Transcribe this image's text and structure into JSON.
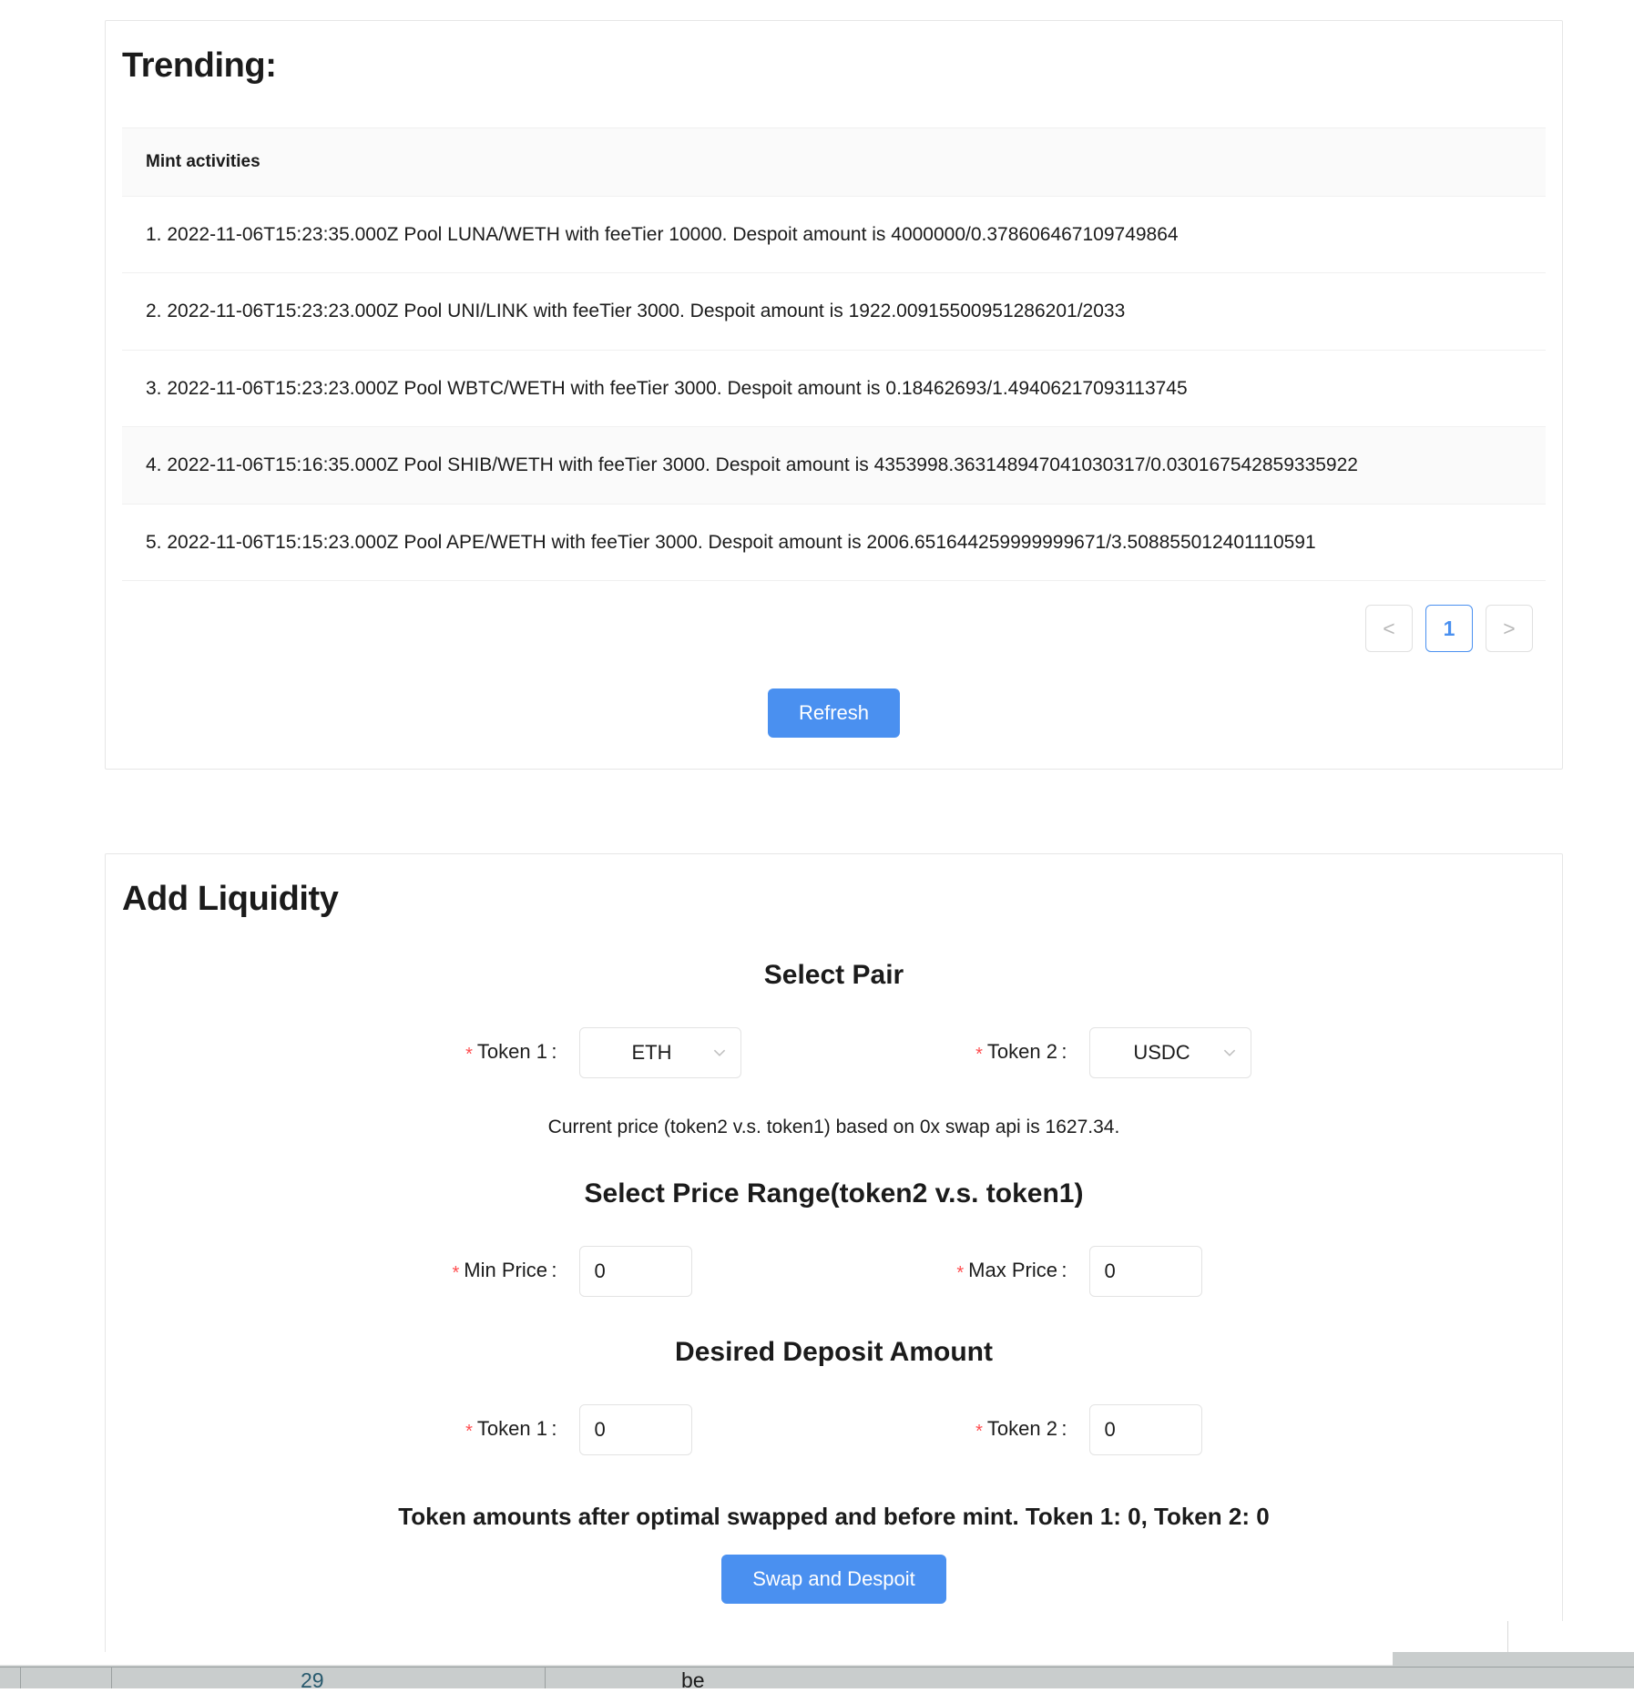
{
  "trending": {
    "title": "Trending:",
    "list_header": "Mint activities",
    "items": [
      "1. 2022-11-06T15:23:35.000Z Pool LUNA/WETH with feeTier 10000. Despoit amount is 4000000/0.378606467109749864",
      "2. 2022-11-06T15:23:23.000Z Pool UNI/LINK with feeTier 3000. Despoit amount is 1922.00915500951286201/2033",
      "3. 2022-11-06T15:23:23.000Z Pool WBTC/WETH with feeTier 3000. Despoit amount is 0.18462693/1.49406217093113745",
      "4. 2022-11-06T15:16:35.000Z Pool SHIB/WETH with feeTier 3000. Despoit amount is 4353998.363148947041030317/0.030167542859335922",
      "5. 2022-11-06T15:15:23.000Z Pool APE/WETH with feeTier 3000. Despoit amount is 2006.651644259999999671/3.508855012401110591"
    ],
    "pagination": {
      "prev_label": "<",
      "next_label": ">",
      "current_page": "1"
    },
    "refresh_label": "Refresh"
  },
  "liquidity": {
    "title": "Add Liquidity",
    "select_pair_heading": "Select Pair",
    "token1_label": "Token 1 :",
    "token2_label": "Token 2 :",
    "token1_value": "ETH",
    "token2_value": "USDC",
    "price_note": "Current price (token2 v.s. token1) based on 0x swap api is 1627.34.",
    "price_range_heading": "Select Price Range(token2 v.s. token1)",
    "min_price_label": "Min Price :",
    "max_price_label": "Max Price :",
    "min_price_value": "0",
    "max_price_value": "0",
    "deposit_heading": "Desired Deposit Amount",
    "deposit_token1_label": "Token 1 :",
    "deposit_token2_label": "Token 2 :",
    "deposit_token1_value": "0",
    "deposit_token2_value": "0",
    "summary": "Token amounts after optimal swapped and before mint. Token 1: 0, Token 2: 0",
    "submit_label": "Swap and Despoit",
    "required_marker": "*"
  },
  "background": {
    "cell_value": "29",
    "cell_text_right": "be"
  },
  "colors": {
    "accent": "#4a90f0",
    "required": "#ff4d4f",
    "border": "#e6e6e6",
    "row_alt": "#fafafa"
  }
}
